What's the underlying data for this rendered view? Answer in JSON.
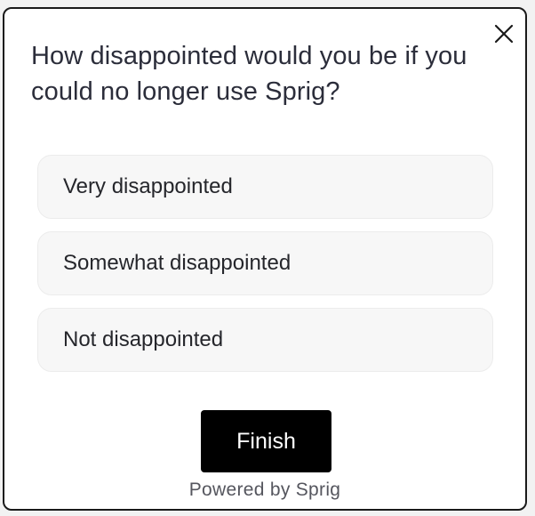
{
  "survey": {
    "question": "How disappointed would you be if you could no longer use Sprig?",
    "options": [
      {
        "label": "Very disappointed"
      },
      {
        "label": "Somewhat disappointed"
      },
      {
        "label": "Not disappointed"
      }
    ],
    "finish_label": "Finish",
    "powered_by": "Powered by Sprig"
  },
  "icons": {
    "close": "close-icon"
  }
}
